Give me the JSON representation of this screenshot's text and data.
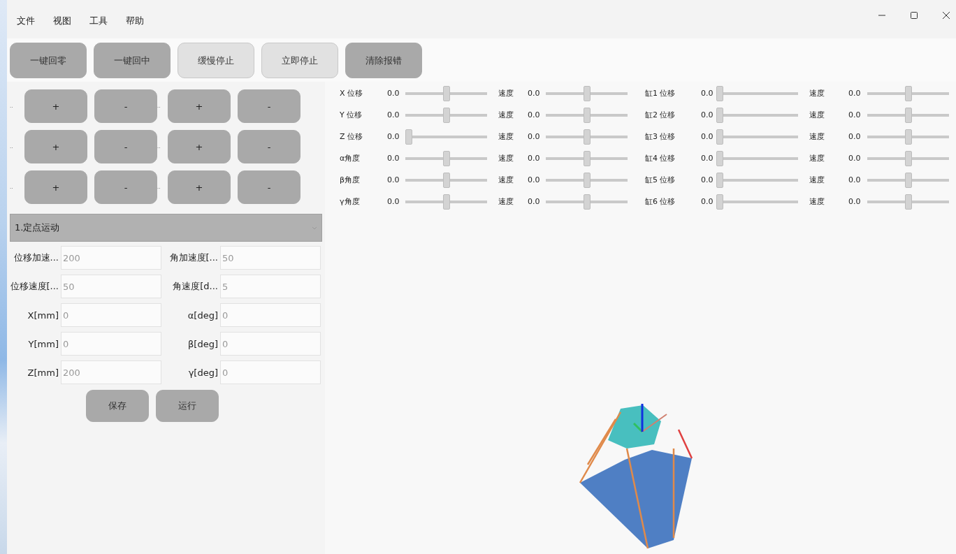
{
  "menu": [
    "文件",
    "视图",
    "工具",
    "帮助"
  ],
  "toolbar": [
    {
      "label": "一键回零",
      "kind": "dark"
    },
    {
      "label": "一键回中",
      "kind": "dark"
    },
    {
      "label": "缓慢停止",
      "kind": "light"
    },
    {
      "label": "立即停止",
      "kind": "light"
    },
    {
      "label": "清除报错",
      "kind": "dark"
    }
  ],
  "jog_rows": [
    [
      {
        "label": "..",
        "plus": "+",
        "minus": "-"
      },
      {
        "label": "..",
        "plus": "+",
        "minus": "-"
      }
    ],
    [
      {
        "label": "..",
        "plus": "+",
        "minus": "-"
      },
      {
        "label": "..",
        "plus": "+",
        "minus": "-"
      }
    ],
    [
      {
        "label": "..",
        "plus": "+",
        "minus": "-"
      },
      {
        "label": "..",
        "plus": "+",
        "minus": "-"
      }
    ]
  ],
  "mode_select": {
    "value": "1.定点运动"
  },
  "form_rows": [
    [
      {
        "label": "位移加速...",
        "placeholder": "200"
      },
      {
        "label": "角加速度[...",
        "placeholder": "50"
      }
    ],
    [
      {
        "label": "位移速度[...",
        "placeholder": "50"
      },
      {
        "label": "角速度[d...",
        "placeholder": "5"
      }
    ],
    [
      {
        "label": "X[mm]",
        "placeholder": "0"
      },
      {
        "label": "α[deg]",
        "placeholder": "0"
      }
    ],
    [
      {
        "label": "Y[mm]",
        "placeholder": "0"
      },
      {
        "label": "β[deg]",
        "placeholder": "0"
      }
    ],
    [
      {
        "label": "Z[mm]",
        "placeholder": "200"
      },
      {
        "label": "γ[deg]",
        "placeholder": "0"
      }
    ]
  ],
  "form_buttons": [
    "保存",
    "运行"
  ],
  "slider_blocks": [
    [
      {
        "position": {
          "label": "X 位移",
          "value": "0.0",
          "level": 0.5
        },
        "speed": {
          "label": "速度",
          "value": "0.0",
          "level": 0.5
        }
      },
      {
        "position": {
          "label": "Y 位移",
          "value": "0.0",
          "level": 0.5
        },
        "speed": {
          "label": "速度",
          "value": "0.0",
          "level": 0.5
        }
      },
      {
        "position": {
          "label": "Z 位移",
          "value": "0.0",
          "level": 0
        },
        "speed": {
          "label": "速度",
          "value": "0.0",
          "level": 0.5
        }
      },
      {
        "position": {
          "label": "α角度",
          "value": "0.0",
          "level": 0.5
        },
        "speed": {
          "label": "速度",
          "value": "0.0",
          "level": 0.5
        }
      },
      {
        "position": {
          "label": "β角度",
          "value": "0.0",
          "level": 0.5
        },
        "speed": {
          "label": "速度",
          "value": "0.0",
          "level": 0.5
        }
      },
      {
        "position": {
          "label": "γ角度",
          "value": "0.0",
          "level": 0.5
        },
        "speed": {
          "label": "速度",
          "value": "0.0",
          "level": 0.5
        }
      }
    ],
    [
      {
        "position": {
          "label": "缸1 位移",
          "value": "0.0",
          "level": 0
        },
        "speed": {
          "label": "速度",
          "value": "0.0",
          "level": 0.5
        }
      },
      {
        "position": {
          "label": "缸2 位移",
          "value": "0.0",
          "level": 0
        },
        "speed": {
          "label": "速度",
          "value": "0.0",
          "level": 0.5
        }
      },
      {
        "position": {
          "label": "缸3 位移",
          "value": "0.0",
          "level": 0
        },
        "speed": {
          "label": "速度",
          "value": "0.0",
          "level": 0.5
        }
      },
      {
        "position": {
          "label": "缸4 位移",
          "value": "0.0",
          "level": 0
        },
        "speed": {
          "label": "速度",
          "value": "0.0",
          "level": 0.5
        }
      },
      {
        "position": {
          "label": "缸5 位移",
          "value": "0.0",
          "level": 0
        },
        "speed": {
          "label": "速度",
          "value": "0.0",
          "level": 0.5
        }
      },
      {
        "position": {
          "label": "缸6 位移",
          "value": "0.0",
          "level": 0
        },
        "speed": {
          "label": "速度",
          "value": "0.0",
          "level": 0.5
        }
      }
    ]
  ]
}
